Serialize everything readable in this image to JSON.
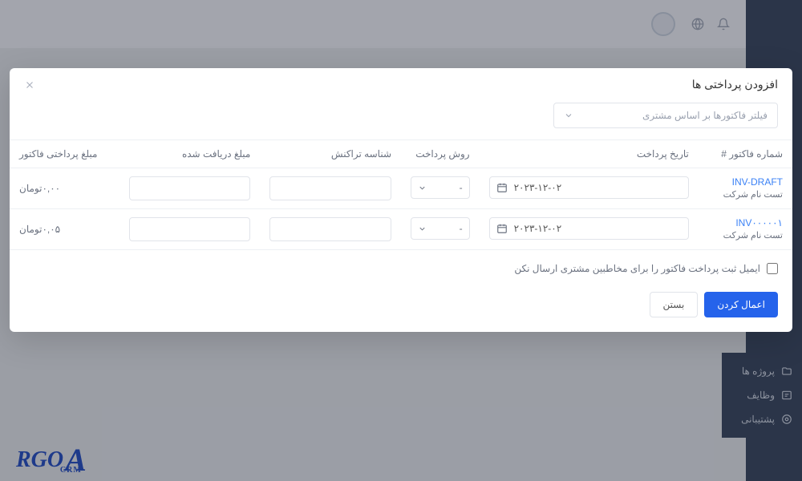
{
  "modal": {
    "title": "افزودن پرداختی ها",
    "filter_placeholder": "فیلتر فاکتورها بر اساس مشتری",
    "headers": {
      "invoice_no": "شماره فاکتور #",
      "payment_date": "تاریخ پرداخت",
      "payment_method": "روش پرداخت",
      "transaction_id": "شناسه تراکنش",
      "amount_received": "مبلغ دریافت شده",
      "invoice_amount": "مبلغ پرداختی فاکتور"
    },
    "rows": [
      {
        "invoice_link": "INV-DRAFT",
        "company": "تست نام شرکت",
        "date": "۲۰۲۳-۱۲-۰۲",
        "method": "-",
        "transaction": "",
        "received": "",
        "amount": "۰,۰۰تومان"
      },
      {
        "invoice_link": "INV۰۰۰۰۰۱",
        "company": "تست نام شرکت",
        "date": "۲۰۲۳-۱۲-۰۲",
        "method": "-",
        "transaction": "",
        "received": "",
        "amount": "۰,۰۵تومان"
      }
    ],
    "checkbox_label": "ایمیل ثبت پرداخت فاکتور را برای مخاطبین مشتری ارسال نکن",
    "apply_label": "اعمال کردن",
    "close_label": "بستن"
  },
  "sidebar": {
    "items": [
      {
        "label": "پروژه ها"
      },
      {
        "label": "وظایف"
      },
      {
        "label": "پشتیبانی"
      }
    ]
  },
  "logo": {
    "a": "A",
    "rest": "RGO",
    "sub": "CRM"
  }
}
